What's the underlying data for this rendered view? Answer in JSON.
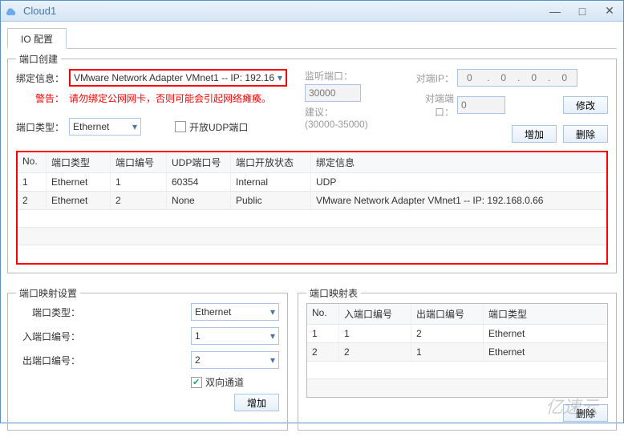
{
  "window": {
    "title": "Cloud1"
  },
  "tab": {
    "label": "IO 配置"
  },
  "portCreate": {
    "legend": "端口创建",
    "bindLabel": "绑定信息：",
    "bindValue": "VMware Network Adapter VMnet1 -- IP: 192.16",
    "warnLabel": "警告：",
    "warnText": "请勿绑定公网网卡，否则可能会引起网络瘫痪。",
    "typeLabel": "端口类型：",
    "typeValue": "Ethernet",
    "openUdpLabel": "开放UDP端口",
    "listenLabel": "监听端口：",
    "listenValue": "30000",
    "adviceLabel": "建议：",
    "adviceValue": "(30000-35000)",
    "peerIpLabel": "对端IP：",
    "peerIpValue": "0    .   0   .   0   .   0",
    "peerPortLabel": "对端端口：",
    "peerPortValue": "0",
    "modifyBtn": "修改",
    "addBtn": "增加",
    "deleteBtn": "删除",
    "columns": [
      "No.",
      "端口类型",
      "端口编号",
      "UDP端口号",
      "端口开放状态",
      "绑定信息"
    ],
    "rows": [
      {
        "no": "1",
        "type": "Ethernet",
        "num": "1",
        "udp": "60354",
        "status": "Internal",
        "bind": "UDP"
      },
      {
        "no": "2",
        "type": "Ethernet",
        "num": "2",
        "udp": "None",
        "status": "Public",
        "bind": "VMware Network Adapter VMnet1 -- IP: 192.168.0.66"
      }
    ]
  },
  "mapSettings": {
    "legend": "端口映射设置",
    "typeLabel": "端口类型：",
    "typeValue": "Ethernet",
    "inLabel": "入端口编号：",
    "inValue": "1",
    "outLabel": "出端口编号：",
    "outValue": "2",
    "bidirLabel": "双向通道",
    "addBtn": "增加"
  },
  "mapTable": {
    "legend": "端口映射表",
    "columns": [
      "No.",
      "入端口编号",
      "出端口编号",
      "端口类型"
    ],
    "rows": [
      {
        "no": "1",
        "in": "1",
        "out": "2",
        "type": "Ethernet"
      },
      {
        "no": "2",
        "in": "2",
        "out": "1",
        "type": "Ethernet"
      }
    ],
    "deleteBtn": "删除"
  },
  "watermark": "亿速云"
}
